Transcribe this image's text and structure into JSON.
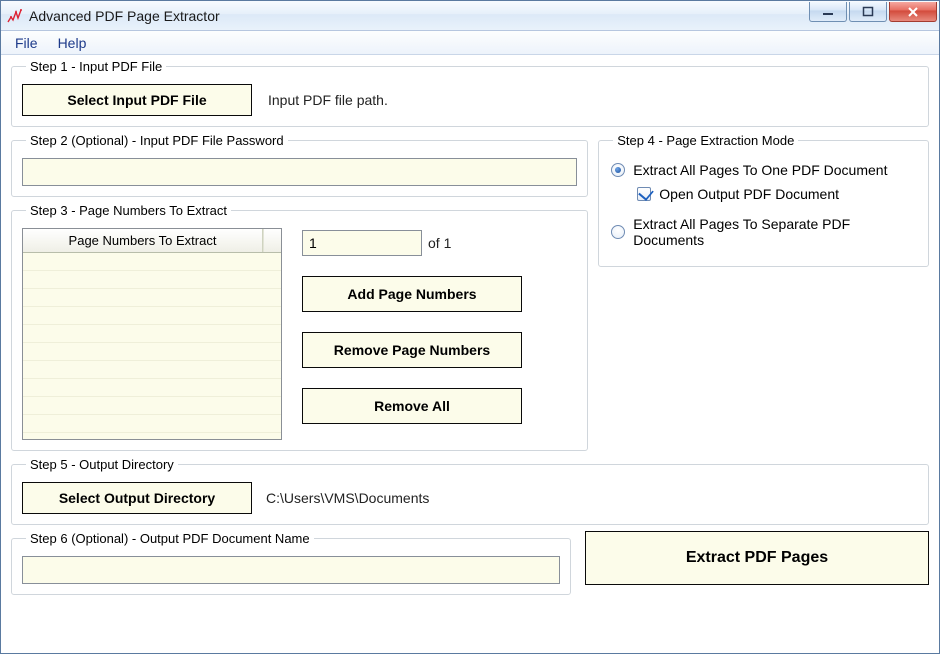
{
  "window": {
    "title": "Advanced PDF Page Extractor"
  },
  "menu": {
    "file": "File",
    "help": "Help"
  },
  "step1": {
    "legend": "Step 1 - Input PDF File",
    "button": "Select Input PDF File",
    "path_label": "Input PDF file path."
  },
  "step2": {
    "legend": "Step 2 (Optional) - Input PDF File Password",
    "value": ""
  },
  "step3": {
    "legend": "Step 3 - Page Numbers To Extract",
    "table_header": "Page Numbers To Extract",
    "page_from": "1",
    "page_of_label": "of 1",
    "add_btn": "Add Page Numbers",
    "remove_btn": "Remove Page Numbers",
    "remove_all_btn": "Remove All"
  },
  "step4": {
    "legend": "Step 4 - Page Extraction Mode",
    "opt_one": "Extract All Pages To One PDF Document",
    "open_output": "Open Output PDF Document",
    "opt_separate": "Extract All Pages To Separate PDF Documents"
  },
  "step5": {
    "legend": "Step 5 - Output Directory",
    "button": "Select Output Directory",
    "path": "C:\\Users\\VMS\\Documents"
  },
  "step6": {
    "legend": "Step 6 (Optional) - Output PDF Document Name",
    "value": ""
  },
  "extract": {
    "button": "Extract PDF Pages"
  }
}
